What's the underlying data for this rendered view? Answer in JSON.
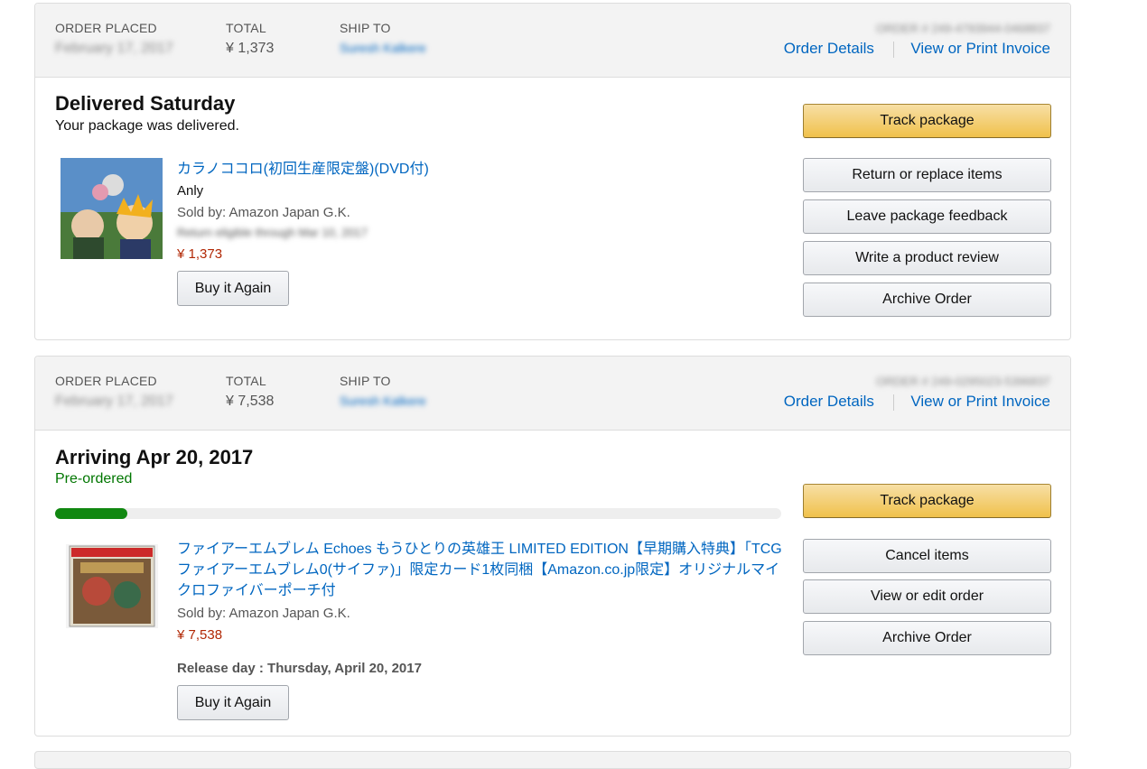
{
  "orders": [
    {
      "header": {
        "order_placed_label": "ORDER PLACED",
        "order_placed_value": "February 17, 2017",
        "total_label": "TOTAL",
        "total_value": "¥ 1,373",
        "ship_to_label": "SHIP TO",
        "ship_to_value": "Suresh Kalkere",
        "order_number": "ORDER # 249-4793944-0468837",
        "order_details_link": "Order Details",
        "invoice_link": "View or Print Invoice"
      },
      "status": "Delivered Saturday",
      "substatus": "Your package was delivered.",
      "item": {
        "title": "カラノココロ(初回生産限定盤)(DVD付)",
        "artist": "Anly",
        "sold_by": "Sold by: Amazon Japan G.K.",
        "return_note": "Return eligible through Mar 10, 2017",
        "price": "¥ 1,373",
        "buy_again": "Buy it Again"
      },
      "actions": {
        "primary": "Track package",
        "secondary": [
          "Return or replace items",
          "Leave package feedback",
          "Write a product review",
          "Archive Order"
        ]
      }
    },
    {
      "header": {
        "order_placed_label": "ORDER PLACED",
        "order_placed_value": "February 17, 2017",
        "total_label": "TOTAL",
        "total_value": "¥ 7,538",
        "ship_to_label": "SHIP TO",
        "ship_to_value": "Suresh Kalkere",
        "order_number": "ORDER # 249-0295023-5396837",
        "order_details_link": "Order Details",
        "invoice_link": "View or Print Invoice"
      },
      "status": "Arriving Apr 20, 2017",
      "substatus": "Pre-ordered",
      "progress": 0.1,
      "item": {
        "title": "ファイアーエムブレム Echoes もうひとりの英雄王 LIMITED EDITION【早期購入特典】「TCGファイアーエムブレム0(サイファ)」限定カード1枚同梱【Amazon.co.jp限定】オリジナルマイクロファイバーポーチ付",
        "sold_by": "Sold by: Amazon Japan G.K.",
        "price": "¥ 7,538",
        "release": "Release day : Thursday, April 20, 2017",
        "buy_again": "Buy it Again"
      },
      "actions": {
        "primary": "Track package",
        "secondary": [
          "Cancel items",
          "View or edit order",
          "Archive Order"
        ]
      }
    }
  ],
  "colors": {
    "link": "#0066c0",
    "price": "#b12704",
    "preorder": "#007600",
    "progress": "#118811"
  }
}
